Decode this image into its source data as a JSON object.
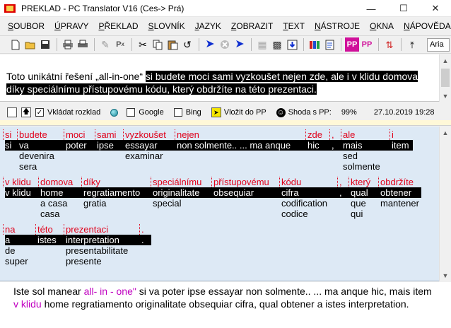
{
  "window": {
    "title": "PREKLAD - PC Translator V16 (Ces-> Prá)"
  },
  "menu": [
    {
      "first": "S",
      "rest": "OUBOR"
    },
    {
      "first": "Ú",
      "rest": "PRAVY"
    },
    {
      "first": "P",
      "rest": "ŘEKLAD"
    },
    {
      "first": "S",
      "rest": "LOVNÍK"
    },
    {
      "first": "J",
      "rest": "AZYK"
    },
    {
      "first": "Z",
      "rest": "OBRAZIT"
    },
    {
      "first": "T",
      "rest": "EXT"
    },
    {
      "first": "N",
      "rest": "ÁSTROJE"
    },
    {
      "first": "O",
      "rest": "KNA"
    },
    {
      "first": "N",
      "rest": "ÁPOVĚDA"
    }
  ],
  "toolbar": {
    "font_name": "Aria"
  },
  "source": {
    "plain": "Toto unikátní řešení „all-in-one“ ",
    "selected": "si budete moci sami vyzkoušet nejen zde, ale i v klidu domova díky speciálnímu přístupovému kódu, který obdržíte na této prezentaci."
  },
  "status": {
    "keep_format": "Vkládat rozklad",
    "google": "Google",
    "bing": "Bing",
    "insert_pp": "Vložit do PP",
    "match_label": "Shoda s PP:",
    "match_value": "99%",
    "datetime": "27.10.2019 19:28"
  },
  "analysis": {
    "tokens": [
      {
        "src": "si",
        "tr": "si",
        "alts": []
      },
      {
        "src": "budete",
        "tr": "va",
        "alts": [
          "devenira",
          "sera"
        ]
      },
      {
        "src": "moci",
        "tr": "poter",
        "alts": []
      },
      {
        "src": "sami",
        "tr": "ipse",
        "alts": []
      },
      {
        "src": "vyzkoušet",
        "tr": "essayar",
        "alts": [
          "examinar"
        ]
      },
      {
        "src": "nejen",
        "tr": "non solmente.. ... ma anque",
        "alts": []
      },
      {
        "src": "zde",
        "tr": "hic",
        "alts": []
      },
      {
        "src": ",",
        "tr": ",",
        "alts": []
      },
      {
        "src": "ale",
        "tr": "mais",
        "alts": [
          "sed",
          "solmente"
        ]
      },
      {
        "src": "i",
        "tr": "item",
        "alts": []
      },
      {
        "src": "v klidu",
        "tr": "v klidu",
        "alts": []
      },
      {
        "src": "domova",
        "tr": "home",
        "alts": [
          "a casa",
          "casa"
        ]
      },
      {
        "src": "díky",
        "tr": "regratiamento",
        "alts": [
          "gratia"
        ]
      },
      {
        "src": "speciálnímu",
        "tr": "originalitate",
        "alts": [
          "special"
        ]
      },
      {
        "src": "přístupovému",
        "tr": "obsequiar",
        "alts": []
      },
      {
        "src": "kódu",
        "tr": "cifra",
        "alts": [
          "codification",
          "codice"
        ]
      },
      {
        "src": ",",
        "tr": ",",
        "alts": []
      },
      {
        "src": "který",
        "tr": "qual",
        "alts": [
          "que",
          "qui"
        ]
      },
      {
        "src": "obdržíte",
        "tr": "obtener",
        "alts": [
          "mantener"
        ]
      },
      {
        "src": "na",
        "tr": "a",
        "alts": [
          "de",
          "super"
        ]
      },
      {
        "src": "této",
        "tr": "istes",
        "alts": []
      },
      {
        "src": "prezentaci",
        "tr": "interpretation",
        "alts": [
          "presentabilitate",
          "presente"
        ]
      },
      {
        "src": ".",
        "tr": ".",
        "alts": []
      }
    ]
  },
  "target": {
    "p1": "Iste sol manear ",
    "hl1": "all- in - one\"",
    "p2": " si va poter ipse essayar non solmente.. ... ma anque hic, mais item ",
    "hl2": "v klidu",
    "p3": " home regratiamento originalitate obsequiar cifra, qual obtener a istes interpretation."
  }
}
